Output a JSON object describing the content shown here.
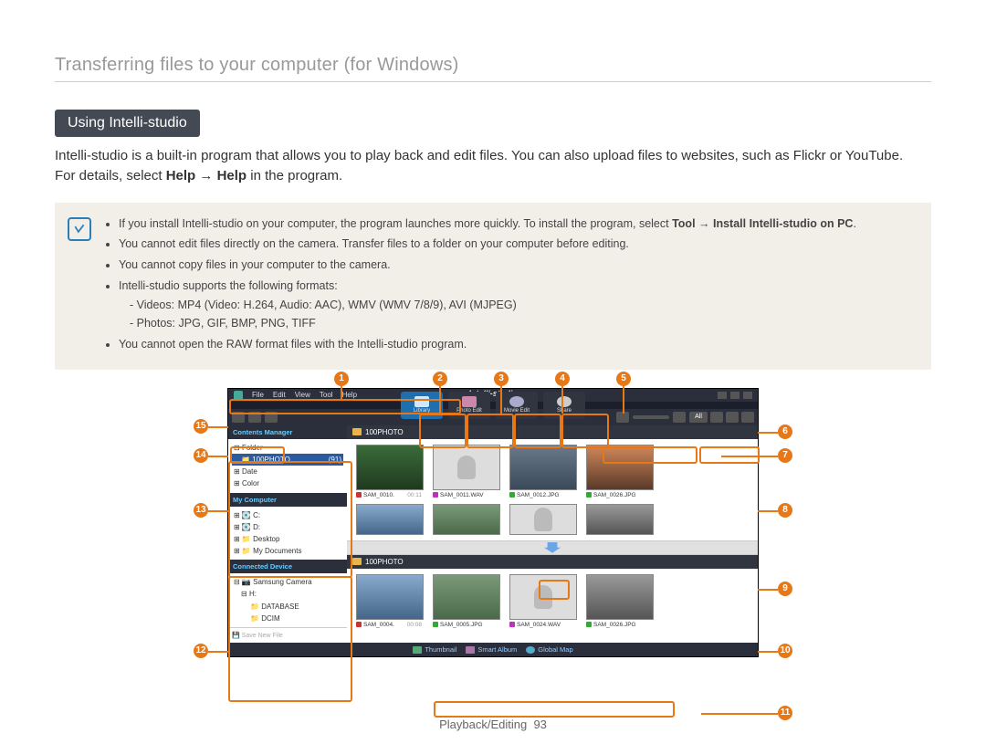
{
  "breadcrumb": "Transferring files to your computer (for Windows)",
  "section_badge": "Using Intelli-studio",
  "intro_1": "Intelli-studio is a built-in program that allows you to play back and edit files. You can also upload files to websites, such as Flickr or YouTube. ",
  "intro_2a": "For details, select ",
  "intro_2b": "Help",
  "intro_2c": " → ",
  "intro_2d": "Help",
  "intro_2e": " in the program.",
  "notes": {
    "b1_pre": "If you install Intelli-studio on your computer, the program launches more quickly. To install the program, select ",
    "b1_bold": "Tool → Install Intelli-studio on PC",
    "b1_post": ".",
    "b2": "You cannot edit files directly on the camera. Transfer files to a folder on your computer before editing.",
    "b3": "You cannot copy files in your computer to the camera.",
    "b4": "Intelli-studio supports the following formats:",
    "b4s1": "Videos: MP4 (Video: H.264, Audio: AAC), WMV (WMV 7/8/9), AVI (MJPEG)",
    "b4s2": "Photos: JPG, GIF, BMP, PNG, TIFF",
    "b5": "You cannot open the RAW format files with the Intelli-studio program."
  },
  "app": {
    "brand": "Intelli-studio",
    "menu": [
      "File",
      "Edit",
      "View",
      "Tool",
      "Help"
    ],
    "toolbar": {
      "library": "Library",
      "photo": "Photo Edit",
      "movie": "Movie Edit",
      "share": "Share"
    },
    "right_icons_all": "All",
    "side": {
      "contents_hdr": "Contents Manager",
      "folder_label": "Folder",
      "folder_sel": "100PHOTO",
      "folder_count": "(91)",
      "date": "Date",
      "color": "Color",
      "mycomp_hdr": "My Computer",
      "c": "C:",
      "d": "D:",
      "desktop": "Desktop",
      "mydocs": "My Documents",
      "device_hdr": "Connected Device",
      "camera": "Samsung Camera",
      "h": "H:",
      "database": "DATABASE",
      "dcim": "DCIM",
      "save_new": "Save New File"
    },
    "folder_name": "100PHOTO",
    "grid1": [
      {
        "name": "SAM_0010.",
        "dur": "00:11",
        "kind": "v",
        "pic": "p1"
      },
      {
        "name": "SAM_0011.WAV",
        "kind": "a",
        "pic": "p2"
      },
      {
        "name": "SAM_0012.JPG",
        "kind": "i",
        "pic": "p3"
      },
      {
        "name": "SAM_0026.JPG",
        "kind": "i",
        "pic": "p4"
      }
    ],
    "grid2": [
      {
        "name": "SAM_0004.",
        "dur": "00:08",
        "kind": "v",
        "pic": "p5"
      },
      {
        "name": "SAM_0005.JPG",
        "kind": "i",
        "pic": "p6"
      },
      {
        "name": "SAM_0024.WAV",
        "kind": "a",
        "pic": "p7"
      },
      {
        "name": "SAM_0026.JPG",
        "kind": "i",
        "pic": "p8"
      }
    ],
    "bottombar": {
      "thumbnail": "Thumbnail",
      "smart": "Smart Album",
      "map": "Global Map"
    }
  },
  "callouts": [
    "1",
    "2",
    "3",
    "4",
    "5",
    "6",
    "7",
    "8",
    "9",
    "10",
    "11",
    "12",
    "13",
    "14",
    "15"
  ],
  "footer_section": "Playback/Editing",
  "footer_page": "93"
}
